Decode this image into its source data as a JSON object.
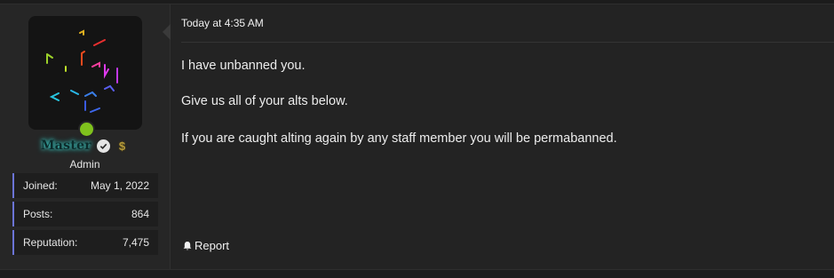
{
  "user": {
    "username": "Master",
    "role": "Admin",
    "verified_icon": "verified-check-icon",
    "badge_icon": "dollar-badge-icon"
  },
  "stats": [
    {
      "label": "Joined:",
      "value": "May 1, 2022"
    },
    {
      "label": "Posts:",
      "value": "864"
    },
    {
      "label": "Reputation:",
      "value": "7,475"
    }
  ],
  "post": {
    "timestamp": "Today at 4:35 AM",
    "lines": [
      "I have unbanned you.",
      "Give us all of your alts below.",
      "If you are caught alting again by any staff member you will be permabanned."
    ]
  },
  "actions": {
    "report_label": "Report"
  },
  "colors": {
    "accent": "#6b74d6",
    "online": "#7fc21d",
    "username_glow": "#3fd0c9"
  }
}
